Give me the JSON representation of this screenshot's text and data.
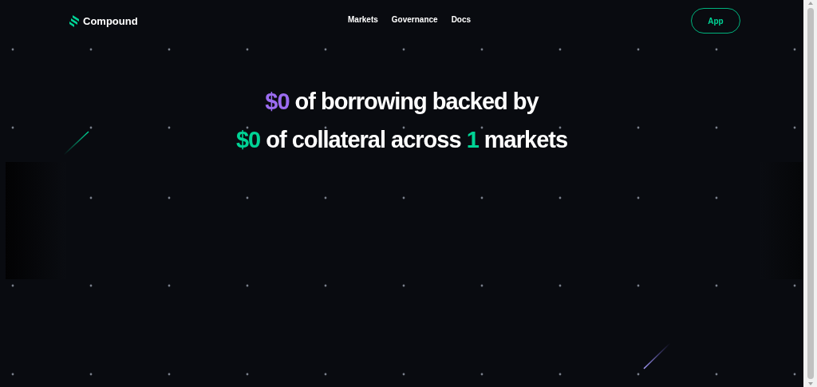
{
  "brand": {
    "name": "Compound"
  },
  "nav": [
    {
      "label": "Markets"
    },
    {
      "label": "Governance"
    },
    {
      "label": "Docs"
    }
  ],
  "app_button": {
    "label": "App"
  },
  "headline": [
    [
      {
        "text": "$0",
        "color": "#9b6cf0"
      },
      {
        "text": " of borrowing backed by"
      }
    ],
    [
      {
        "text": "$0",
        "color": "#00d395"
      },
      {
        "text": " of collateral across "
      },
      {
        "text": "1",
        "color": "#00d395"
      },
      {
        "text": " markets"
      }
    ]
  ]
}
